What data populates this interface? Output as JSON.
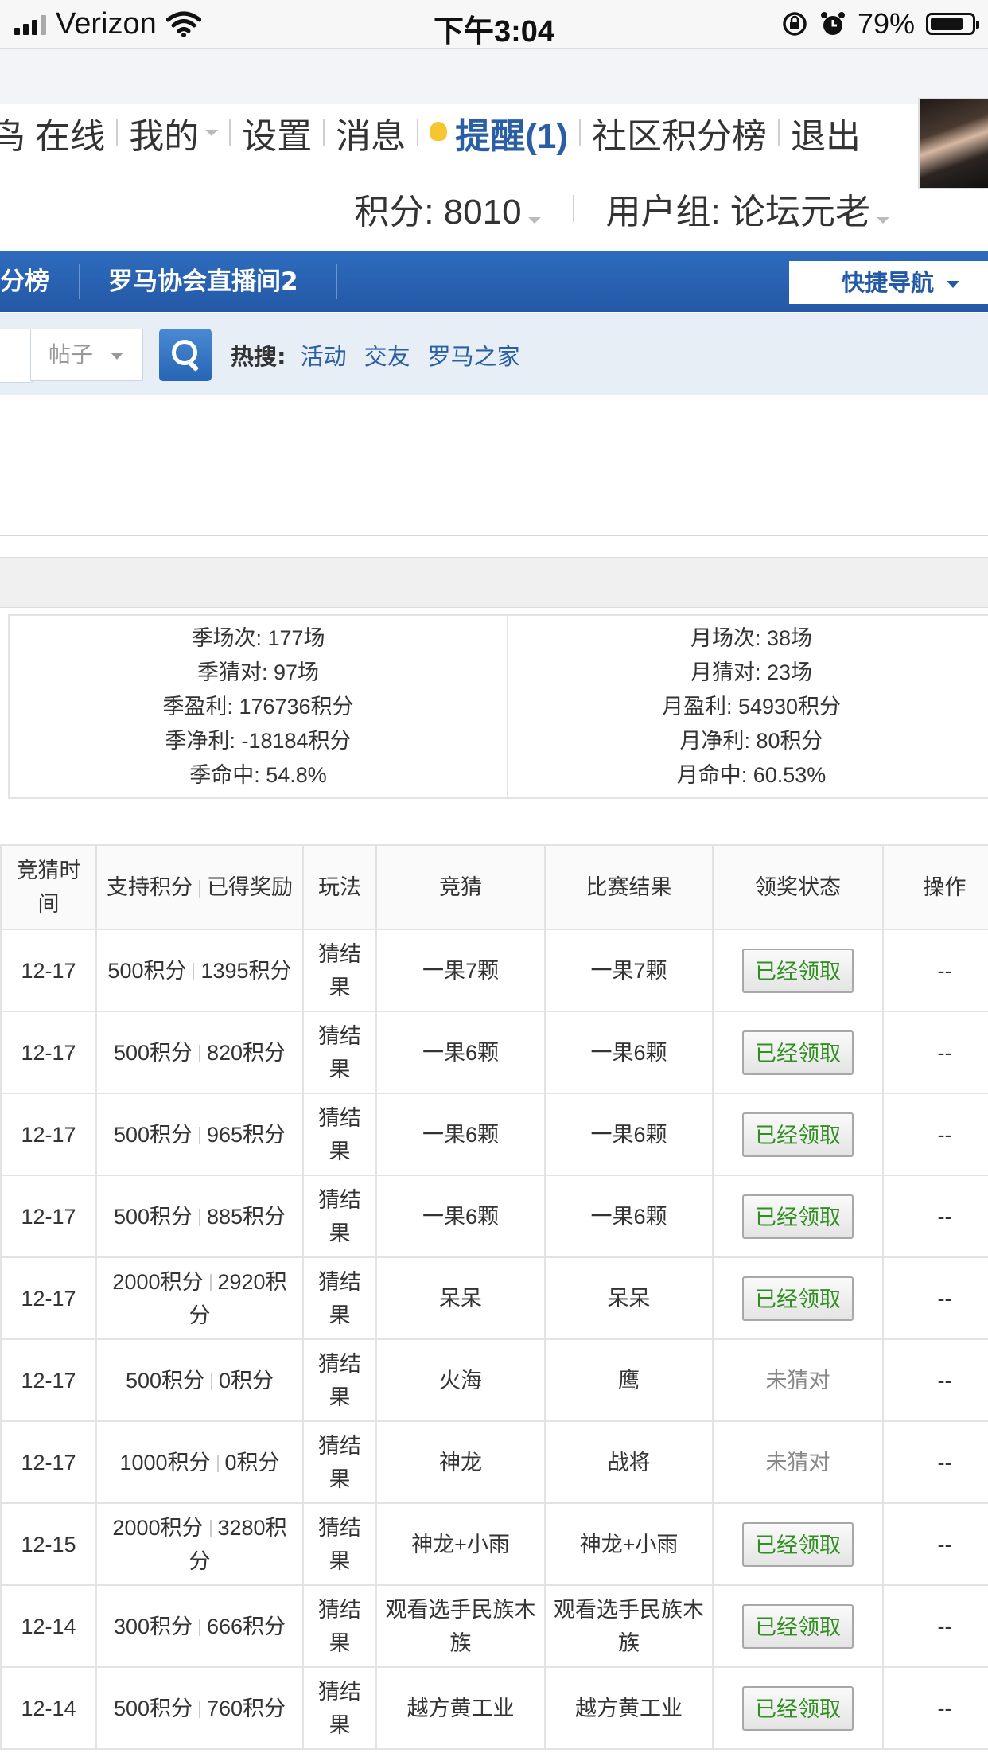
{
  "status_bar": {
    "carrier": "Verizon",
    "time": "下午3:04",
    "battery": "79%",
    "battery_level": 0.79
  },
  "user_menu": [
    {
      "label": "鸟 在线",
      "caret": false,
      "sep": true
    },
    {
      "label": "我的",
      "caret": true,
      "sep": true
    },
    {
      "label": "设置",
      "caret": false,
      "sep": true
    },
    {
      "label": "消息",
      "caret": false,
      "sep": true
    },
    {
      "label": "提醒(1)",
      "caret": false,
      "sep": true,
      "highlight": true
    },
    {
      "label": "社区积分榜",
      "caret": false,
      "sep": true
    },
    {
      "label": "退出",
      "caret": false,
      "sep": false
    }
  ],
  "user_info": {
    "points": "积分: 8010",
    "group": "用户组: 论坛元老"
  },
  "nav": {
    "tab1": "分榜",
    "tab2": "罗马协会直播间2",
    "quicknav": "快捷导航"
  },
  "search": {
    "type": "帖子",
    "hot_label": "热搜:",
    "hot_links": [
      "活动",
      "交友",
      "罗马之家"
    ]
  },
  "stats": {
    "season": [
      "季场次: 177场",
      "季猜对: 97场",
      "季盈利: 176736积分",
      "季净利: -18184积分",
      "季命中: 54.8%"
    ],
    "month": [
      "月场次: 38场",
      "月猜对: 23场",
      "月盈利: 54930积分",
      "月净利: 80积分",
      "月命中: 60.53%"
    ]
  },
  "table": {
    "headers": [
      "竞猜时间",
      "支持积分",
      "已得奖励",
      "玩法",
      "竞猜",
      "比赛结果",
      "领奖状态",
      "操作"
    ],
    "rows": [
      {
        "date": "12-17",
        "support": "500积分",
        "reward": "1395积分",
        "mode": "猜结果",
        "guess": "一果7颗",
        "result": "一果7颗",
        "result_color": "red",
        "status": "已经领取",
        "claimed": true,
        "op": "--"
      },
      {
        "date": "12-17",
        "support": "500积分",
        "reward": "820积分",
        "mode": "猜结果",
        "guess": "一果6颗",
        "result": "一果6颗",
        "result_color": "red",
        "status": "已经领取",
        "claimed": true,
        "op": "--"
      },
      {
        "date": "12-17",
        "support": "500积分",
        "reward": "965积分",
        "mode": "猜结果",
        "guess": "一果6颗",
        "result": "一果6颗",
        "result_color": "red",
        "status": "已经领取",
        "claimed": true,
        "op": "--"
      },
      {
        "date": "12-17",
        "support": "500积分",
        "reward": "885积分",
        "mode": "猜结果",
        "guess": "一果6颗",
        "result": "一果6颗",
        "result_color": "red",
        "status": "已经领取",
        "claimed": true,
        "op": "--"
      },
      {
        "date": "12-17",
        "support": "2000积分",
        "reward": "2920积分",
        "mode": "猜结果",
        "guess": "呆呆",
        "result": "呆呆",
        "result_color": "red",
        "status": "已经领取",
        "claimed": true,
        "op": "--"
      },
      {
        "date": "12-17",
        "support": "500积分",
        "reward": "0积分",
        "mode": "猜结果",
        "guess": "火海",
        "result": "鹰",
        "result_color": "green",
        "status": "未猜对",
        "claimed": false,
        "op": "--"
      },
      {
        "date": "12-17",
        "support": "1000积分",
        "reward": "0积分",
        "mode": "猜结果",
        "guess": "神龙",
        "result": "战将",
        "result_color": "green",
        "status": "未猜对",
        "claimed": false,
        "op": "--"
      },
      {
        "date": "12-15",
        "support": "2000积分",
        "reward": "3280积分",
        "mode": "猜结果",
        "guess": "神龙+小雨",
        "result": "神龙+小雨",
        "result_color": "red",
        "status": "已经领取",
        "claimed": true,
        "op": "--"
      },
      {
        "date": "12-14",
        "support": "300积分",
        "reward": "666积分",
        "mode": "猜结果",
        "guess": "观看选手民族木族",
        "result": "观看选手民族木族",
        "result_color": "red",
        "status": "已经领取",
        "claimed": true,
        "op": "--"
      },
      {
        "date": "12-14",
        "support": "500积分",
        "reward": "760积分",
        "mode": "猜结果",
        "guess": "越方黄工业",
        "result": "越方黄工业",
        "result_color": "red",
        "status": "已经领取",
        "claimed": true,
        "op": "--"
      }
    ]
  }
}
